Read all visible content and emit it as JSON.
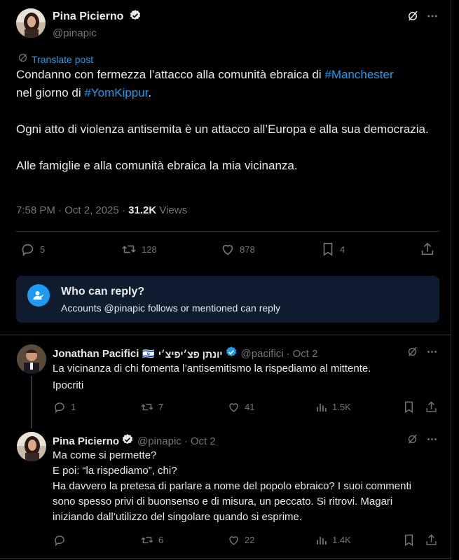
{
  "main_post": {
    "author_name": "Pina Picierno",
    "author_handle": "@pinapic",
    "translate_label": "Translate post",
    "line1_before": "Condanno con fermezza l’attacco alla comunità ebraica di ",
    "hashtag1": "#Manchester",
    "line1_mid": "nel giorno di ",
    "hashtag2": "#YomKippur",
    "line1_end": ".",
    "paragraph2": "Ogni atto di violenza antisemita è un attacco all’Europa e alla sua democrazia.",
    "paragraph3": "Alle famiglie e alla comunità ebraica la mia vicinanza.",
    "time": "7:58 PM",
    "date": "Oct 2, 2025",
    "views_count": "31.2K",
    "views_label": "Views",
    "replies": "5",
    "reposts": "128",
    "likes": "878",
    "bookmarks": "4"
  },
  "reply_restriction": {
    "title": "Who can reply?",
    "body": "Accounts @pinapic follows or mentioned can reply"
  },
  "reply1": {
    "author_name": "Jonathan Pacifici",
    "flag": "🇮🇱",
    "hebrew_name": "יונתן פצ׳יפיצ׳י",
    "author_handle": "@pacifici",
    "date": "Oct 2",
    "text_line1": "La vicinanza di chi fomenta l’antisemitismo la rispediamo al mittente.",
    "text_line2": "Ipocriti",
    "replies": "1",
    "reposts": "7",
    "likes": "41",
    "views": "1.5K"
  },
  "reply2": {
    "author_name": "Pina Picierno",
    "author_handle": "@pinapic",
    "date": "Oct 2",
    "line1": "Ma come si permette?",
    "line2": "E poi: “la rispediamo”, chi?",
    "line3": "Ha davvero la pretesa di parlare a nome del popolo ebraico? I suoi commenti sono spesso privi di buonsenso e di misura, un peccato. Si ritrovi. Magari iniziando dall’utilizzo del singolare quando si esprime.",
    "replies": "",
    "reposts": "6",
    "likes": "22",
    "views": "1.4K"
  },
  "separator": "·",
  "colors": {
    "accent": "#1d9bf0",
    "muted": "#71767b",
    "text": "#e7e9ea",
    "divider": "#2f3336",
    "reply_box_bg": "#0f1b2e"
  }
}
